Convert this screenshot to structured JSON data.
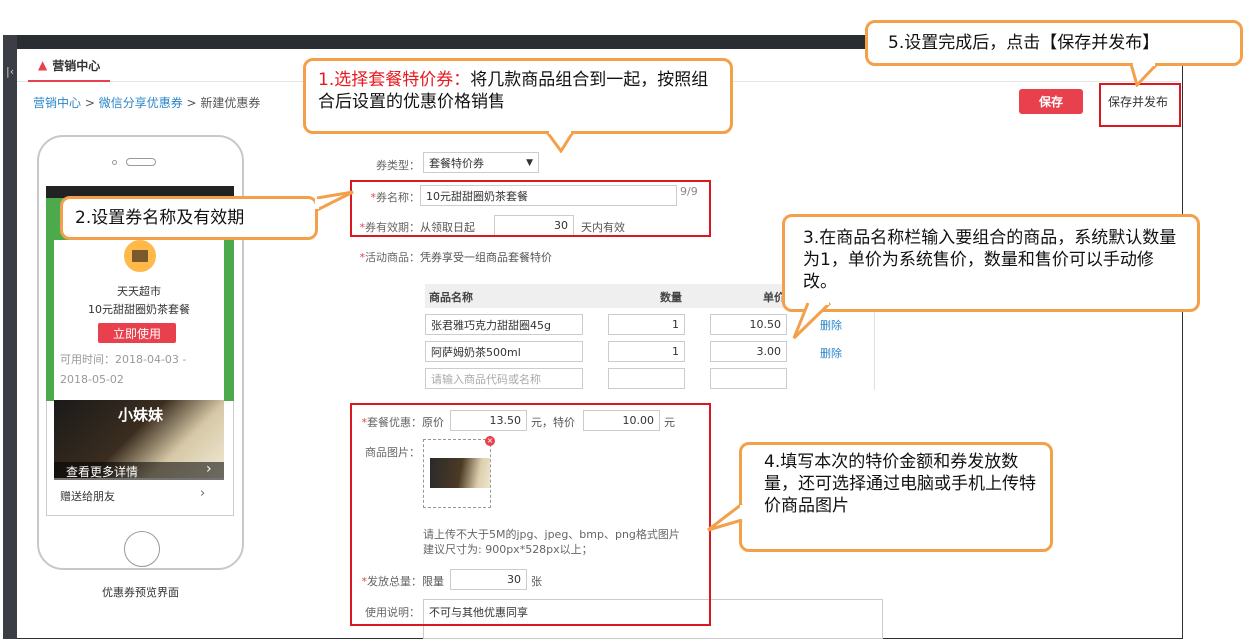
{
  "app": {
    "tab_label": "营销中心",
    "collapse_glyph": "|‹"
  },
  "breadcrumb": {
    "part1": "营销中心",
    "sep1": " > ",
    "part2": "微信分享优惠券",
    "sep2": " > ",
    "current": "新建优惠券"
  },
  "toolbar": {
    "save_label": "保存",
    "publish_label": "保存并发布"
  },
  "preview": {
    "store_name": "天天超市",
    "coupon_name": "10元甜甜圈奶茶套餐",
    "use_button": "立即使用",
    "use_time": "可用时间：2018-04-03 - 2018-05-02",
    "photo_text": "小妹妹",
    "more_details": "查看更多详情",
    "share_friend": "赠送给朋友",
    "caption": "优惠券预览界面"
  },
  "form": {
    "type_label": "券类型：",
    "type_value": "套餐特价券",
    "name_label": "券名称：",
    "name_value": "10元甜甜圈奶茶套餐",
    "name_count": "9/9",
    "validity_label": "券有效期：",
    "validity_prefix": "从领取日起",
    "validity_days": "30",
    "validity_suffix": "天内有效",
    "goods_label": "活动商品：",
    "goods_desc": "凭券享受一组商品套餐特价",
    "goods_columns": [
      "商品名称",
      "数量",
      "单价"
    ],
    "goods_rows": [
      {
        "name": "张君雅巧克力甜甜圈45g",
        "qty": "1",
        "price": "10.50",
        "action": "删除"
      },
      {
        "name": "阿萨姆奶茶500ml",
        "qty": "1",
        "price": "3.00",
        "action": "删除"
      }
    ],
    "goods_placeholder": "请输入商品代码或名称",
    "package_label": "套餐优惠：",
    "orig_label": "原价",
    "orig_price": "13.50",
    "special_label": "元，特价",
    "special_price": "10.00",
    "yuan": "元",
    "image_label": "商品图片：",
    "upload_hint1": "请上传不大于5M的jpg、jpeg、bmp、png格式图片",
    "upload_hint2": "建议尺寸为: 900px*528px以上；",
    "total_label": "发放总量：",
    "limit_label": "限量",
    "total_value": "30",
    "total_unit": "张",
    "notes_label": "使用说明：",
    "notes_value": "不可与其他优惠同享"
  },
  "callouts": {
    "c1_highlight": "1.选择套餐特价券：",
    "c1_rest": "将几款商品组合到一起，按照组合后设置的优惠价格销售",
    "c2": "2.设置券名称及有效期",
    "c3": "3.在商品名称栏输入要组合的商品，系统默认数量为1，单价为系统售价，数量和售价可以手动修改。",
    "c4": "4.填写本次的特价金额和券发放数量，还可选择通过电脑或手机上传特价商品图片",
    "c5": "5.设置完成后，点击【保存并发布】"
  },
  "colors": {
    "accent": "#e8404d",
    "callout_border": "#f4a04a",
    "highlight_box": "#d9181f",
    "link": "#2a86c8"
  }
}
